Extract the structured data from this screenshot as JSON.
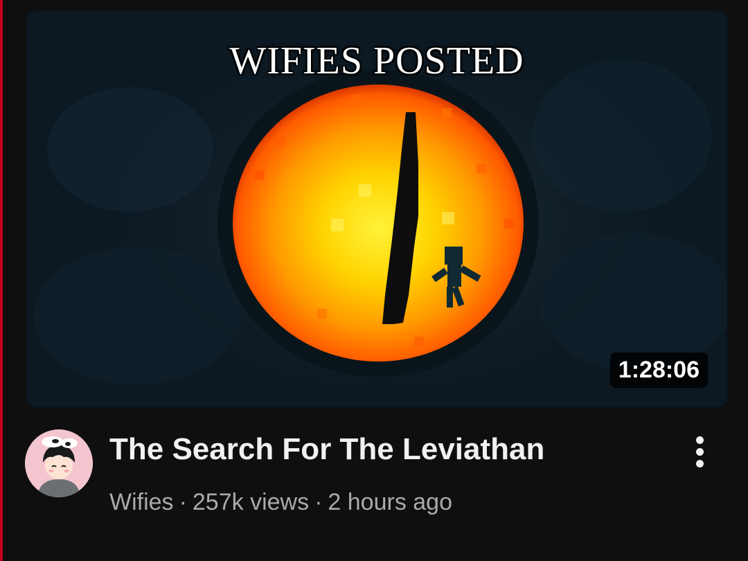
{
  "video": {
    "thumbnail_caption": "WIFIES POSTED",
    "duration": "1:28:06",
    "title": "The Search For The Leviathan",
    "channel": "Wifies",
    "separator": "·",
    "views": "257k views",
    "age": "2 hours ago"
  },
  "icons": {
    "more": "more-vertical-icon",
    "avatar": "channel-avatar"
  },
  "colors": {
    "background": "#0f0f0f",
    "title": "#f1f1f1",
    "subtext": "#aaaaaa",
    "edge_accent": "#c4001a",
    "eye_orange": "#ff8a00",
    "eye_yellow": "#ffd400"
  }
}
